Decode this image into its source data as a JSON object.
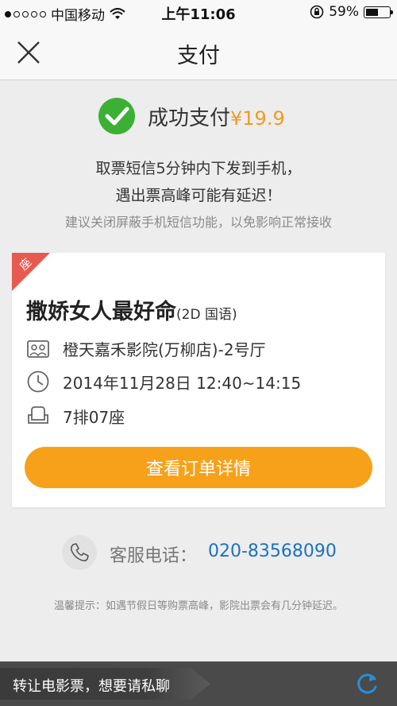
{
  "status_bar": {
    "carrier": "中国移动",
    "time": "上午11:06",
    "battery": "59%",
    "battery_level": 0.59
  },
  "nav": {
    "title": "支付"
  },
  "success": {
    "text": "成功支付",
    "price": "¥19.9"
  },
  "notice": {
    "line1": "取票短信5分钟内下发到手机，",
    "line2": "遇出票高峰可能有延迟！",
    "line3": "建议关闭屏蔽手机短信功能，以免影响正常接收"
  },
  "ticket": {
    "corner_label": "座",
    "movie_title": "撒娇女人最好命",
    "format": "(2D 国语)",
    "cinema": "橙天嘉禾影院(万柳店)-2号厅",
    "showtime": "2014年11月28日 12:40~14:15",
    "seat": "7排07座",
    "button_label": "查看订单详情"
  },
  "service": {
    "label": "客服电话：",
    "number": "020-83568090"
  },
  "tip": "温馨提示：如遇节假日等购票高峰，影院出票会有几分钟延迟。",
  "bottom_bar": {
    "banner_text": "转让电影票，想要请私聊"
  },
  "colors": {
    "accent": "#f7a11a",
    "success": "#3cb034",
    "link": "#1a72c2",
    "corner": "#e8594f"
  }
}
